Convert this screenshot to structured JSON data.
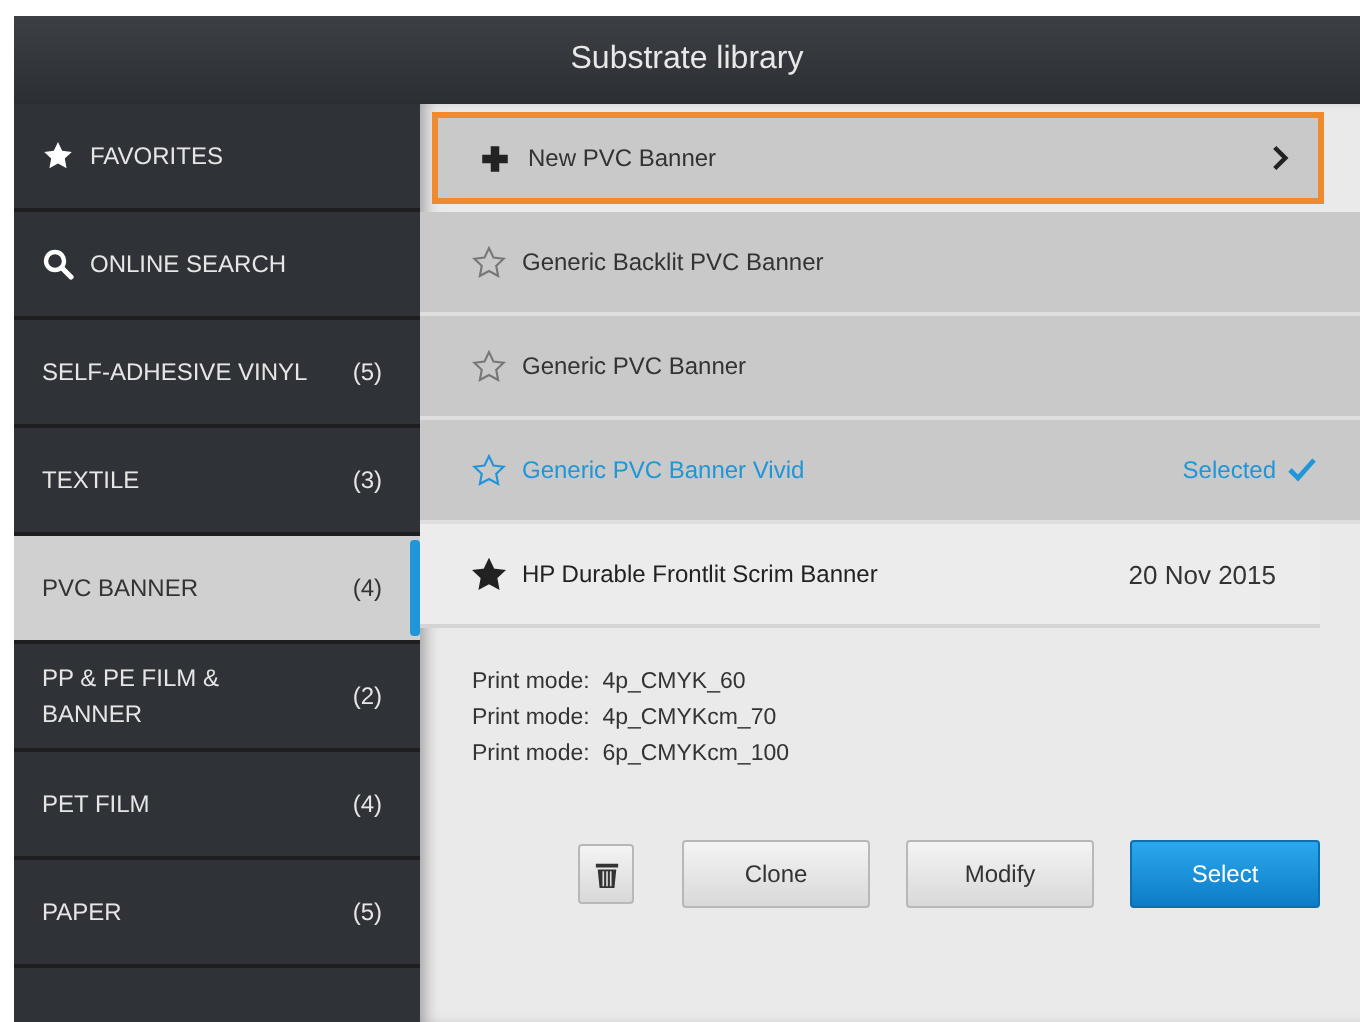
{
  "window": {
    "title": "Substrate library"
  },
  "sidebar": {
    "items": [
      {
        "kind": "favorites",
        "label": "FAVORITES",
        "selected": false
      },
      {
        "kind": "search",
        "label": "ONLINE SEARCH",
        "selected": false
      },
      {
        "kind": "category",
        "label": "SELF-ADHESIVE VINYL",
        "count": "(5)",
        "selected": false
      },
      {
        "kind": "category",
        "label": "TEXTILE",
        "count": "(3)",
        "selected": false
      },
      {
        "kind": "category",
        "label": "PVC BANNER",
        "count": "(4)",
        "selected": true
      },
      {
        "kind": "category",
        "label": "PP & PE FILM & BANNER",
        "count": "(2)",
        "selected": false
      },
      {
        "kind": "category",
        "label": "PET FILM",
        "count": "(4)",
        "selected": false
      },
      {
        "kind": "category",
        "label": "PAPER",
        "count": "(5)",
        "selected": false
      }
    ]
  },
  "substrates": [
    {
      "kind": "new",
      "label": "New PVC Banner",
      "highlighted": true
    },
    {
      "kind": "substrate",
      "label": "Generic Backlit PVC Banner",
      "favorite": false,
      "selected": false,
      "expanded": false
    },
    {
      "kind": "substrate",
      "label": "Generic PVC Banner",
      "favorite": false,
      "selected": false,
      "expanded": false
    },
    {
      "kind": "substrate",
      "label": "Generic PVC Banner Vivid",
      "favorite": false,
      "selected": true,
      "status": "Selected",
      "expanded": false
    },
    {
      "kind": "substrate",
      "label": "HP Durable Frontlit Scrim Banner",
      "favorite": true,
      "selected": false,
      "expanded": true,
      "date": "20 Nov 2015",
      "print_modes": [
        {
          "label": "Print mode:",
          "value": "4p_CMYK_60"
        },
        {
          "label": "Print mode:",
          "value": "4p_CMYKcm_70"
        },
        {
          "label": "Print mode:",
          "value": "6p_CMYKcm_100"
        }
      ],
      "buttons": [
        {
          "kind": "delete"
        },
        {
          "kind": "plain",
          "label": "Clone"
        },
        {
          "kind": "plain",
          "label": "Modify"
        },
        {
          "kind": "primary",
          "label": "Select"
        }
      ]
    }
  ]
}
